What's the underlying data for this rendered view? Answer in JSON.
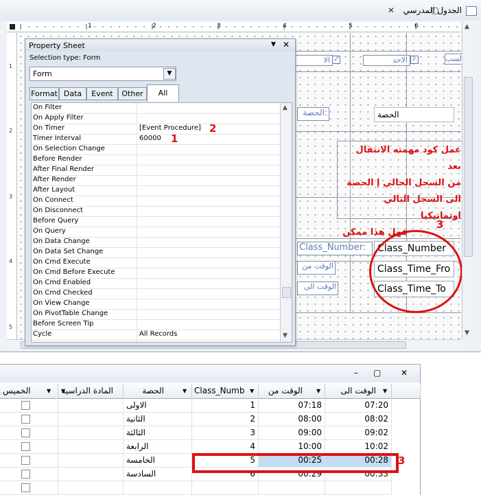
{
  "window": {
    "title": "الجدول المدرسي"
  },
  "ruler": {
    "numbers": [
      "1",
      "2",
      "3",
      "4",
      "5",
      "6"
    ],
    "vnumbers": [
      "1",
      "2",
      "3",
      "4",
      "5"
    ]
  },
  "form_design": {
    "labels_top": [
      "الا",
      "الاحد",
      "لسب"
    ],
    "label_period": "الحصة:",
    "textbox_period": "الحصة",
    "label_class_number": "Class_Number:",
    "label_time_from": "الوقت من",
    "label_time_to": "الوقت الى",
    "textbox_class_number": "Class_Number",
    "textbox_time_from": "Class_Time_Fro",
    "textbox_time_to": "Class_Time_To",
    "note_lines": [
      "عمل كود مهمته الانتقال بعد",
      "من السجل الحالي إ الحصة",
      "الى السجل التالي اوتماتيكيا",
      "فهل هذا ممكن"
    ],
    "annotation_3": "3"
  },
  "property_sheet": {
    "title": "Property Sheet",
    "selection_type": "Selection type:  Form",
    "selected_object": "Form",
    "tabs": [
      "Format",
      "Data",
      "Event",
      "Other",
      "All"
    ],
    "rows": [
      {
        "name": "On Filter",
        "value": ""
      },
      {
        "name": "On Apply Filter",
        "value": ""
      },
      {
        "name": "On Timer",
        "value": "[Event Procedure]"
      },
      {
        "name": "Timer Interval",
        "value": "60000"
      },
      {
        "name": "On Selection Change",
        "value": ""
      },
      {
        "name": "Before Render",
        "value": ""
      },
      {
        "name": "After Final Render",
        "value": ""
      },
      {
        "name": "After Render",
        "value": ""
      },
      {
        "name": "After Layout",
        "value": ""
      },
      {
        "name": "On Connect",
        "value": ""
      },
      {
        "name": "On Disconnect",
        "value": ""
      },
      {
        "name": "Before Query",
        "value": ""
      },
      {
        "name": "On Query",
        "value": ""
      },
      {
        "name": "On Data Change",
        "value": ""
      },
      {
        "name": "On Data Set Change",
        "value": ""
      },
      {
        "name": "On Cmd Execute",
        "value": ""
      },
      {
        "name": "On Cmd Before Execute",
        "value": ""
      },
      {
        "name": "On Cmd Enabled",
        "value": ""
      },
      {
        "name": "On Cmd Checked",
        "value": ""
      },
      {
        "name": "On View Change",
        "value": ""
      },
      {
        "name": "On PivotTable Change",
        "value": ""
      },
      {
        "name": "Before Screen Tip",
        "value": ""
      },
      {
        "name": "Cycle",
        "value": "All Records"
      }
    ],
    "annotation_1": "1",
    "annotation_2": "2"
  },
  "datasheet": {
    "columns": [
      "الخميس",
      "المادة الدراسية",
      "الحصة",
      "Class_Numb",
      "الوقت من",
      "الوقت الى"
    ],
    "rows": [
      {
        "period": "الاولى",
        "class_number": "1",
        "time_from": "07:18",
        "time_to": "07:20"
      },
      {
        "period": "الثانية",
        "class_number": "2",
        "time_from": "08:00",
        "time_to": "08:02"
      },
      {
        "period": "الثالثة",
        "class_number": "3",
        "time_from": "09:00",
        "time_to": "09:02"
      },
      {
        "period": "الرابعة",
        "class_number": "4",
        "time_from": "10:00",
        "time_to": "10:02"
      },
      {
        "period": "الخامسة",
        "class_number": "5",
        "time_from": "00:25",
        "time_to": "00:28"
      },
      {
        "period": "السادسة",
        "class_number": "6",
        "time_from": "00:29",
        "time_to": "00:33"
      }
    ],
    "annotation_3": "3"
  },
  "colors": {
    "annotation_red": "#dd1111",
    "selection_blue": "#c4dcf3"
  }
}
